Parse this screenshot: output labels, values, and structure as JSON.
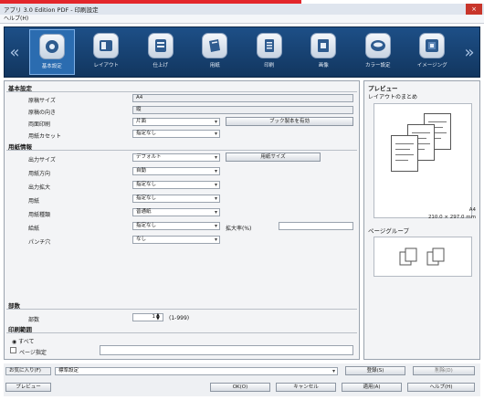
{
  "window": {
    "title": "アプリ 3.0 Edition PDF - 印刷設定",
    "close_label": "×"
  },
  "menubar": {
    "text": "ヘルプ(H)"
  },
  "nav": {
    "prev": "«",
    "next": "»"
  },
  "tabs": [
    {
      "label": "基本設定",
      "icon": "gear-icon",
      "active": true
    },
    {
      "label": "レイアウト",
      "icon": "layout-icon",
      "active": false
    },
    {
      "label": "仕上げ",
      "icon": "finish-icon",
      "active": false
    },
    {
      "label": "用紙",
      "icon": "paper-icon",
      "active": false
    },
    {
      "label": "印刷",
      "icon": "print-icon",
      "active": false
    },
    {
      "label": "画像",
      "icon": "image-icon",
      "active": false
    },
    {
      "label": "カラー設定",
      "icon": "color-icon",
      "active": false
    },
    {
      "label": "イメージング",
      "icon": "imaging-icon",
      "active": false
    }
  ],
  "left": {
    "section_basic": "基本設定",
    "basic_rows": [
      {
        "label": "原稿サイズ",
        "value": "A4"
      },
      {
        "label": "原稿の向き",
        "value": "縦"
      },
      {
        "label": "両面印刷",
        "value": "片面"
      },
      {
        "label": "用紙カセット",
        "value": "指定なし"
      }
    ],
    "booklet_button": "ブック製本を有効",
    "section_paper": "用紙情報",
    "paper_rows": [
      {
        "label": "出力サイズ",
        "value": "デフォルト"
      },
      {
        "label": "用紙方向",
        "value": "自動"
      },
      {
        "label": "出力拡大",
        "value": "指定なし"
      },
      {
        "label": "用紙",
        "value": "指定なし"
      },
      {
        "label": "用紙種類",
        "value": "普通紙"
      },
      {
        "label": "給紙",
        "value": "指定なし"
      },
      {
        "label": "パンチ穴",
        "value": "なし"
      }
    ],
    "custom_size_button": "用紙サイズ",
    "ratio_label": "拡大率(%)",
    "ratio_value": "",
    "section_copies": "部数",
    "copies_label": "部数",
    "copies_value": "1",
    "copies_range": "(1-999)",
    "section_range": "印刷範囲",
    "range_all": "◉ すべて",
    "range_pages": "ページ指定",
    "range_pages_value": ""
  },
  "right": {
    "preview_title": "プレビュー",
    "preview_subtitle": "レイアウトのまとめ",
    "size_label": "A4",
    "size_dims": "210.0 × 297.0 mm",
    "group_title": "ページグループ"
  },
  "bottom": {
    "favorites_label": "お気に入り(F)",
    "favorites_value": "標準設定",
    "register_button": "登録(S)",
    "delete_button": "削除(D)",
    "preview_button": "プレビュー",
    "ok_button": "OK(O)",
    "cancel_button": "キャンセル",
    "apply_button": "適用(A)",
    "help_button": "ヘルプ(H)"
  }
}
